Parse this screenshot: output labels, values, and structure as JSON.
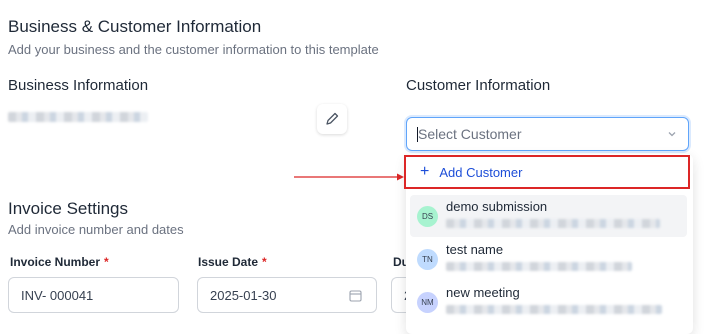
{
  "section": {
    "title": "Business & Customer Information",
    "subtitle": "Add your business and the customer information to this template"
  },
  "business": {
    "heading": "Business Information"
  },
  "customer": {
    "heading": "Customer Information",
    "select_placeholder": "Select Customer",
    "add_label": "Add Customer",
    "options": [
      {
        "initials": "DS",
        "name": "demo submission",
        "avatar_color": "#a7f3d0"
      },
      {
        "initials": "TN",
        "name": "test name",
        "avatar_color": "#bfdbfe"
      },
      {
        "initials": "NM",
        "name": "new meeting",
        "avatar_color": "#c7d2fe"
      }
    ]
  },
  "invoice": {
    "heading": "Invoice Settings",
    "subtitle": "Add invoice number and dates",
    "number_label": "Invoice Number",
    "number_value": "INV- 000041",
    "issue_label": "Issue Date",
    "issue_value": "2025-01-30",
    "due_label_partial": "Du",
    "due_value_partial": "2",
    "required_mark": "*"
  },
  "colors": {
    "accent": "#1d4ed8",
    "highlight_border": "#dc2626"
  }
}
